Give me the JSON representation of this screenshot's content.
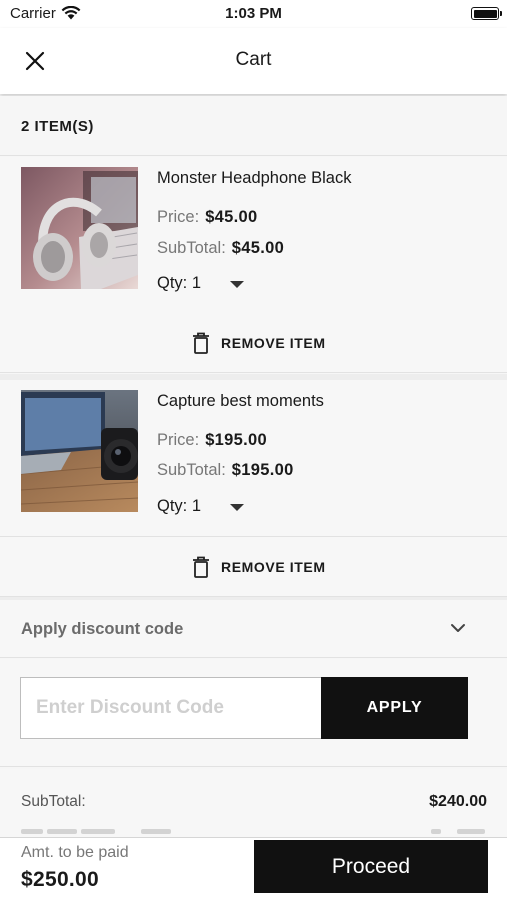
{
  "status_bar": {
    "carrier": "Carrier",
    "time": "1:03 PM"
  },
  "nav": {
    "title": "Cart",
    "close_icon": "close-icon"
  },
  "cart": {
    "count_label": "2 ITEM(S)",
    "items": [
      {
        "name": "Monster Headphone Black",
        "price_label": "Price:",
        "price": "$45.00",
        "subtotal_label": "SubTotal:",
        "subtotal": "$45.00",
        "qty": "Qty: 1",
        "remove_label": "REMOVE ITEM",
        "image_icon": "headphones-image"
      },
      {
        "name": "Capture best moments",
        "price_label": "Price:",
        "price": "$195.00",
        "subtotal_label": "SubTotal:",
        "subtotal": "$195.00",
        "qty": "Qty: 1",
        "remove_label": "REMOVE ITEM",
        "image_icon": "camera-laptop-image"
      }
    ]
  },
  "discount": {
    "header_label": "Apply discount code",
    "placeholder": "Enter Discount Code",
    "apply_label": "APPLY"
  },
  "summary": {
    "subtotal_label": "SubTotal:",
    "subtotal_value": "$240.00"
  },
  "footer": {
    "amount_label": "Amt. to be paid",
    "amount_value": "$250.00",
    "proceed_label": "Proceed"
  },
  "colors": {
    "accent": "#111111",
    "background": "#f6f6f6",
    "muted_text": "#777777"
  }
}
